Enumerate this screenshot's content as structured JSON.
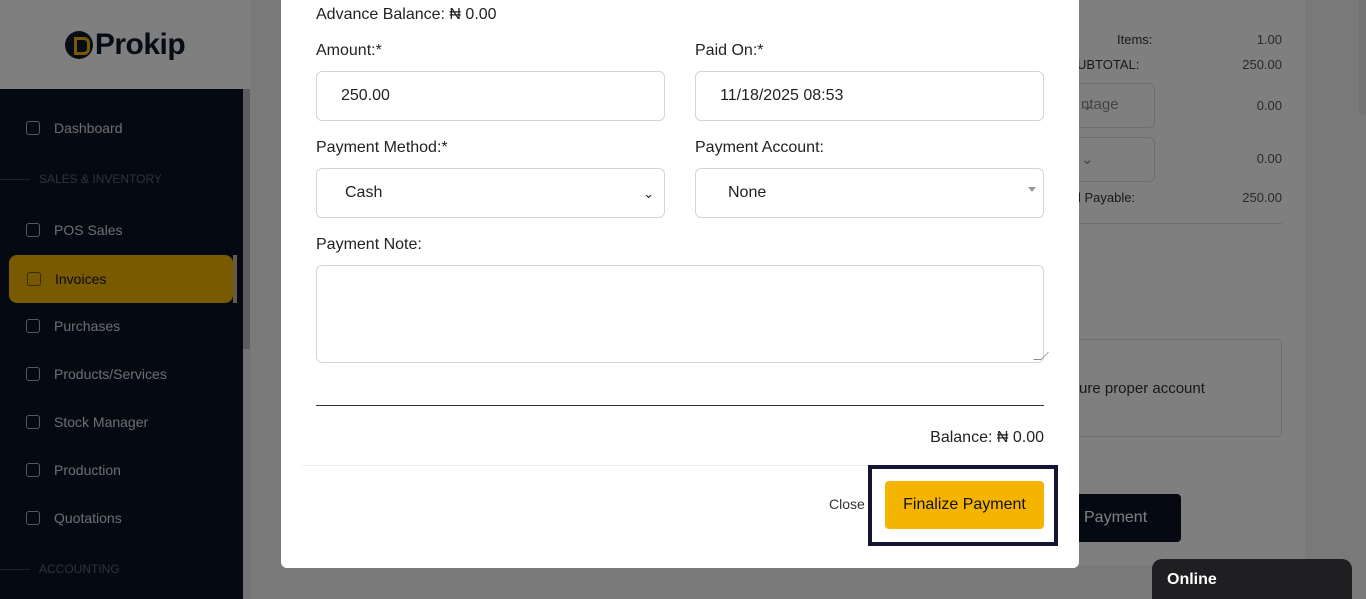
{
  "logo": {
    "text": "Prokip"
  },
  "sidebar": {
    "items": [
      {
        "label": "Dashboard",
        "icon": "home-icon"
      },
      {
        "label": "POS Sales",
        "icon": "bag-icon"
      },
      {
        "label": "Invoices",
        "icon": "invoice-icon",
        "active": true
      },
      {
        "label": "Purchases",
        "icon": "box-icon"
      },
      {
        "label": "Products/Services",
        "icon": "cube-icon"
      },
      {
        "label": "Stock Manager",
        "icon": "stock-icon"
      },
      {
        "label": "Production",
        "icon": "building-icon"
      },
      {
        "label": "Quotations",
        "icon": "quote-icon"
      }
    ],
    "sections": [
      "SALES & INVENTORY",
      "ACCOUNTING"
    ]
  },
  "background": {
    "items_label": "Items:",
    "items_value": "1.00",
    "subtotal_label": "UBTOTAL:",
    "subtotal_value": "250.00",
    "discount_select": "ntage",
    "discount_value": "0.00",
    "tax_value": "0.00",
    "payable_label": "l Payable:",
    "payable_value": "250.00",
    "note_text": "ure proper account",
    "button_label": "Payment"
  },
  "modal": {
    "advance_balance": "Advance Balance: ₦ 0.00",
    "amount_label": "Amount:*",
    "amount_value": "250.00",
    "paid_on_label": "Paid On:*",
    "paid_on_value": "11/18/2025 08:53",
    "method_label": "Payment Method:*",
    "method_value": "Cash",
    "account_label": "Payment Account:",
    "account_value": "None",
    "note_label": "Payment Note:",
    "balance": "Balance: ₦ 0.00",
    "close_label": "Close",
    "finalize_label": "Finalize Payment"
  },
  "chat": {
    "status": "Online"
  },
  "colors": {
    "accent": "#f5b400",
    "navy": "#0b1524"
  }
}
